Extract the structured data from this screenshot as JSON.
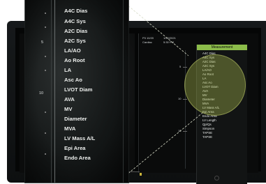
{
  "zoom_menu": {
    "items": [
      "A4C Dias",
      "A4C Sys",
      "A2C Dias",
      "A2C Sys",
      "LA/AO",
      "Ao Root",
      "LA",
      "Asc Ao",
      "LVOT Diam",
      "AVA",
      "MV",
      "Diameter",
      "MVA",
      "LV Mass A/L",
      "Epi Area",
      "Endo Area"
    ]
  },
  "left_scale_labels": [
    "5",
    "10"
  ],
  "small_menu": {
    "header": "Measurement",
    "items": [
      "A4C Dias",
      "A4C Sys",
      "A2C Dias",
      "A2C Sys",
      "LA/AO",
      "Ao Root",
      "LA",
      "Asc Ao",
      "LVOT Diam",
      "AVA",
      "MV",
      "Diameter",
      "MVA",
      "LV Mass A/L",
      "Epi Area",
      "Endo Area",
      "LV Length",
      "Qp/Qs",
      "Simpson",
      "TAPSE",
      "TAPSE"
    ]
  },
  "right_info": {
    "line1": "P3 10/20",
    "line2": "Cardiac",
    "line3": "1/30/2021",
    "line4": "5:30 PM"
  },
  "right_scale_labels": [
    "5",
    "10",
    "15"
  ],
  "colors": {
    "menu_header": "#8cbc4a",
    "magnifier": "#b4c35a",
    "text": "#eef0ee"
  }
}
